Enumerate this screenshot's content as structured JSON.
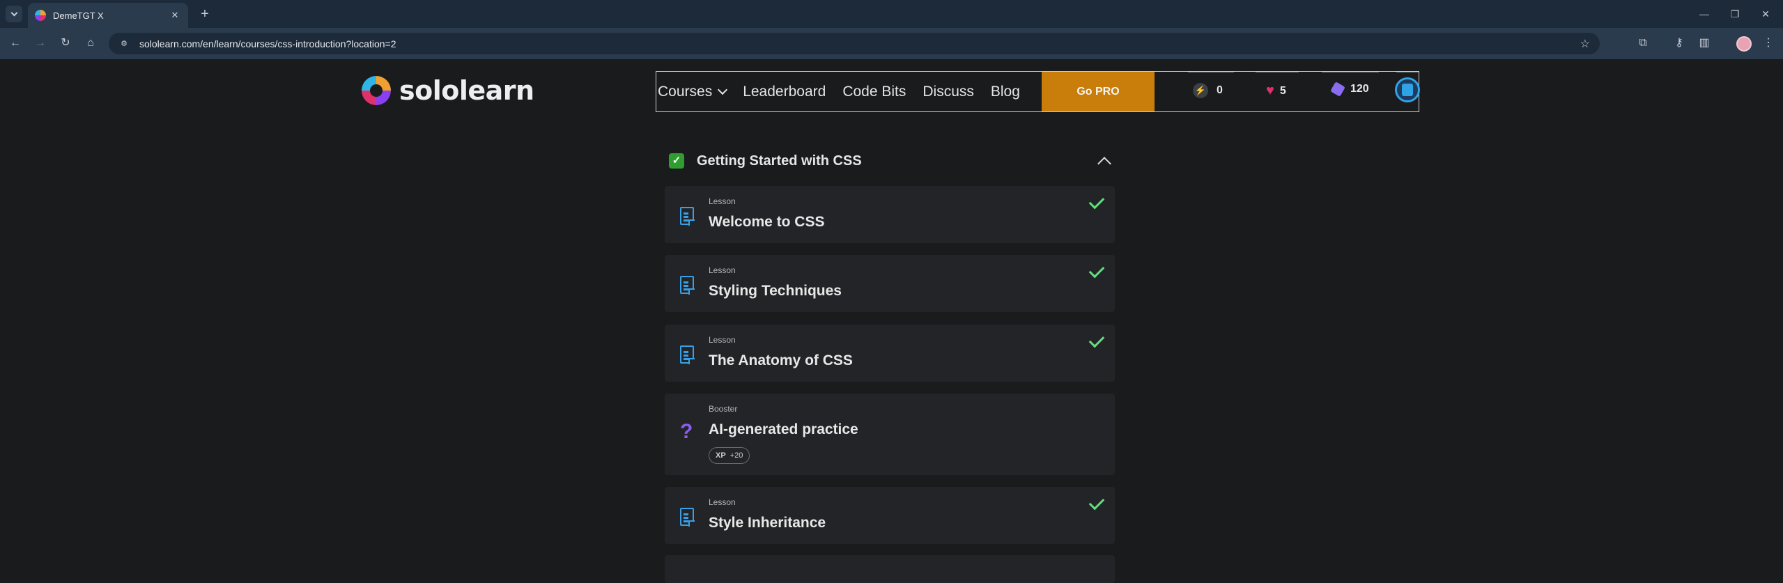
{
  "browser": {
    "tab_title": "DemeTGT X",
    "tab_close": "✕",
    "new_tab": "+",
    "url": "sololearn.com/en/learn/courses/css-introduction?location=2",
    "window_controls": {
      "minimize": "—",
      "restore": "❐",
      "close": "✕"
    }
  },
  "header": {
    "logo_text": "sololearn",
    "nav": {
      "courses": "Courses",
      "leaderboard": "Leaderboard",
      "code_bits": "Code Bits",
      "discuss": "Discuss",
      "blog": "Blog",
      "go_pro": "Go PRO"
    },
    "stats": {
      "streak": "0",
      "hearts": "5",
      "gems": "120"
    }
  },
  "module": {
    "title": "Getting Started with CSS",
    "completed": true
  },
  "items": [
    {
      "type": "Lesson",
      "title": "Welcome to CSS",
      "completed": true
    },
    {
      "type": "Lesson",
      "title": "Styling Techniques",
      "completed": true
    },
    {
      "type": "Lesson",
      "title": "The Anatomy of CSS",
      "completed": true
    },
    {
      "type": "Booster",
      "title": "AI-generated practice",
      "xp_label": "XP",
      "xp_value": "+20"
    },
    {
      "type": "Lesson",
      "title": "Style Inheritance",
      "completed": true
    }
  ],
  "colors": {
    "accent_pro": "#c97d0a",
    "check_green": "#5ee07a",
    "lesson_icon": "#3aa0e6",
    "booster_icon": "#8a5cf0",
    "page_bg": "#1a1b1d"
  },
  "icons": {
    "lesson": "document-icon",
    "booster": "question-mark-icon",
    "done": "checkmark-icon"
  }
}
